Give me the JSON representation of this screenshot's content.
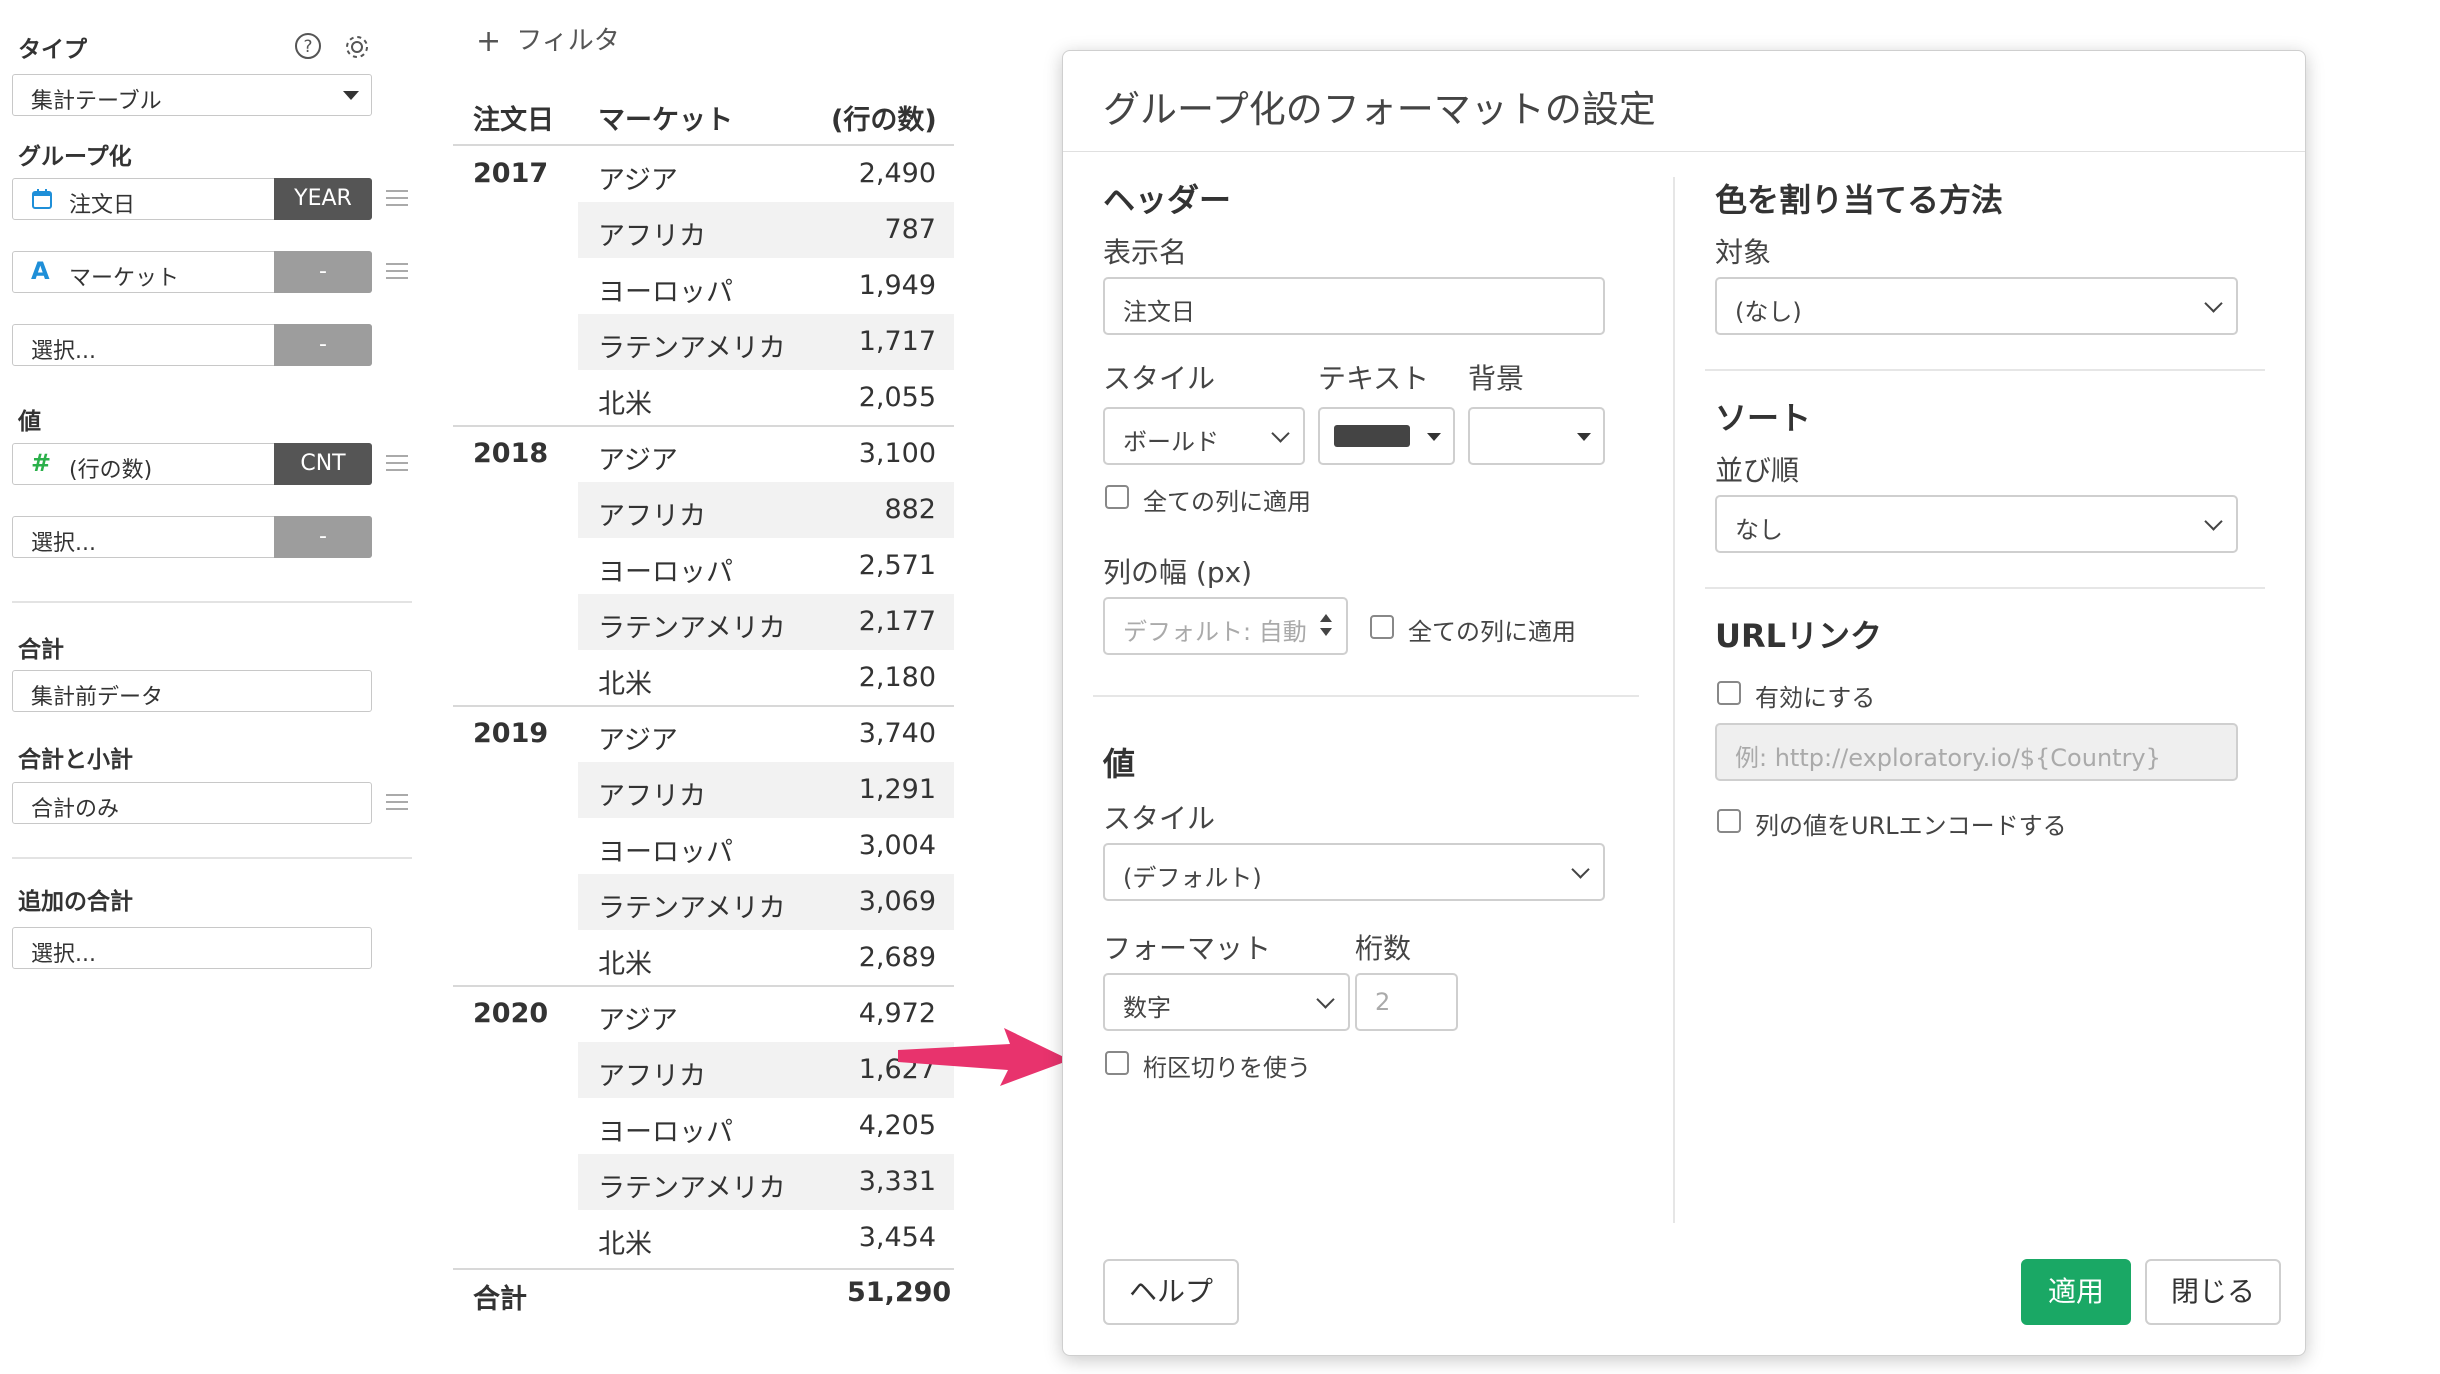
{
  "left_panel": {
    "type_label": "タイプ",
    "type_value": "集計テーブル",
    "group_label": "グループ化",
    "groups": [
      {
        "field": "注文日",
        "agg": "YEAR",
        "icon": "calendar-icon"
      },
      {
        "field": "マーケット",
        "agg": "-",
        "icon": "text-type-icon"
      },
      {
        "field": "選択...",
        "agg": "-"
      }
    ],
    "value_label": "値",
    "values": [
      {
        "field": "(行の数)",
        "agg": "CNT",
        "icon": "number-type-icon"
      },
      {
        "field": "選択...",
        "agg": "-"
      }
    ],
    "total_label": "合計",
    "total_value": "集計前データ",
    "subtotal_label": "合計と小計",
    "subtotal_value": "合計のみ",
    "extra_total_label": "追加の合計",
    "extra_total_value": "選択..."
  },
  "filter": {
    "icon": "plus-icon",
    "label": "フィルタ"
  },
  "table": {
    "headers": {
      "date": "注文日",
      "market": "マーケット",
      "count": "(行の数)"
    },
    "groups": [
      {
        "year": "2017",
        "rows": [
          {
            "market": "アジア",
            "value": "2,490"
          },
          {
            "market": "アフリカ",
            "value": "787"
          },
          {
            "market": "ヨーロッパ",
            "value": "1,949"
          },
          {
            "market": "ラテンアメリカ",
            "value": "1,717"
          },
          {
            "market": "北米",
            "value": "2,055"
          }
        ]
      },
      {
        "year": "2018",
        "rows": [
          {
            "market": "アジア",
            "value": "3,100"
          },
          {
            "market": "アフリカ",
            "value": "882"
          },
          {
            "market": "ヨーロッパ",
            "value": "2,571"
          },
          {
            "market": "ラテンアメリカ",
            "value": "2,177"
          },
          {
            "market": "北米",
            "value": "2,180"
          }
        ]
      },
      {
        "year": "2019",
        "rows": [
          {
            "market": "アジア",
            "value": "3,740"
          },
          {
            "market": "アフリカ",
            "value": "1,291"
          },
          {
            "market": "ヨーロッパ",
            "value": "3,004"
          },
          {
            "market": "ラテンアメリカ",
            "value": "3,069"
          },
          {
            "market": "北米",
            "value": "2,689"
          }
        ]
      },
      {
        "year": "2020",
        "rows": [
          {
            "market": "アジア",
            "value": "4,972"
          },
          {
            "market": "アフリカ",
            "value": "1,627"
          },
          {
            "market": "ヨーロッパ",
            "value": "4,205"
          },
          {
            "market": "ラテンアメリカ",
            "value": "3,331"
          },
          {
            "market": "北米",
            "value": "3,454"
          }
        ]
      }
    ],
    "total_label": "合計",
    "total_value": "51,290"
  },
  "dialog": {
    "title": "グループ化のフォーマットの設定",
    "header_section": "ヘッダー",
    "display_name_label": "表示名",
    "display_name_value": "注文日",
    "style_label": "スタイル",
    "style_value": "ボールド",
    "text_label": "テキスト",
    "text_color": "#444444",
    "bg_label": "背景",
    "apply_all_cols": "全ての列に適用",
    "col_width_label": "列の幅 (px)",
    "col_width_placeholder": "デフォルト: 自動",
    "apply_all_cols_2": "全ての列に適用",
    "value_section": "値",
    "value_style_label": "スタイル",
    "value_style_value": "(デフォルト)",
    "format_label": "フォーマット",
    "format_value": "数字",
    "digits_label": "桁数",
    "digits_placeholder": "2",
    "thousands_sep": "桁区切りを使う",
    "color_section": "色を割り当てる方法",
    "target_label": "対象",
    "target_value": "(なし)",
    "sort_section": "ソート",
    "sort_order_label": "並び順",
    "sort_order_value": "なし",
    "url_section": "URLリンク",
    "url_enable": "有効にする",
    "url_placeholder": "例: http://exploratory.io/${Country}",
    "url_encode": "列の値をURLエンコードする",
    "help_button": "ヘルプ",
    "apply_button": "適用",
    "close_button": "閉じる"
  },
  "colors": {
    "primary": "#1aa865",
    "arrow": "#e8336d",
    "agg_dark": "#555555",
    "agg_gray": "#9d9d9d"
  }
}
